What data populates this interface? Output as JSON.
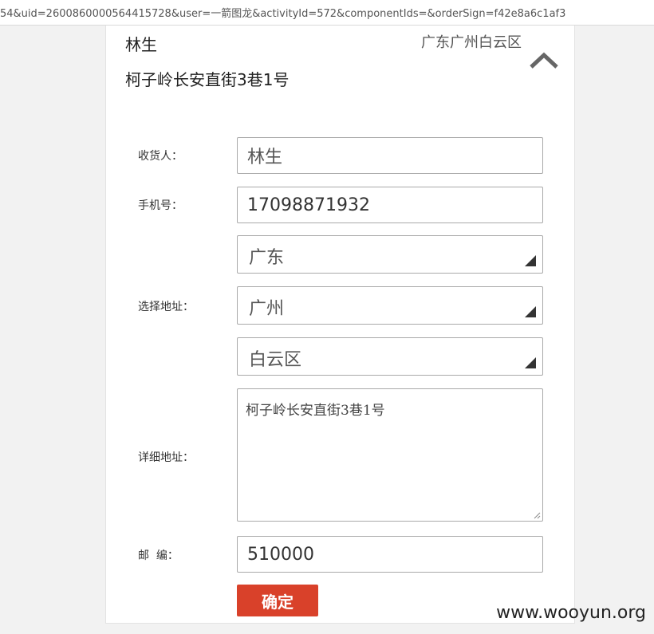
{
  "browser": {
    "url": "54&uid=2600860000564415728&user=一箭图龙&activityId=572&componentIds=&orderSign=f42e8a6c1af3"
  },
  "address_card": {
    "name": "林生",
    "region": "广东广州白云区",
    "street": "柯子岭长安直街3巷1号"
  },
  "form": {
    "recipient_label": "收货人：",
    "recipient_value": "林生",
    "phone_label": "手机号：",
    "phone_value": "17098871932",
    "address_label": "选择地址：",
    "province": "广东",
    "city": "广州",
    "district": "白云区",
    "detail_label": "详细地址：",
    "detail_value": "柯子岭长安直街3巷1号",
    "zip_label": "邮  编：",
    "zip_value": "510000",
    "confirm_label": "确定"
  },
  "watermark": "www.wooyun.org",
  "colors": {
    "accent": "#d9412a"
  }
}
